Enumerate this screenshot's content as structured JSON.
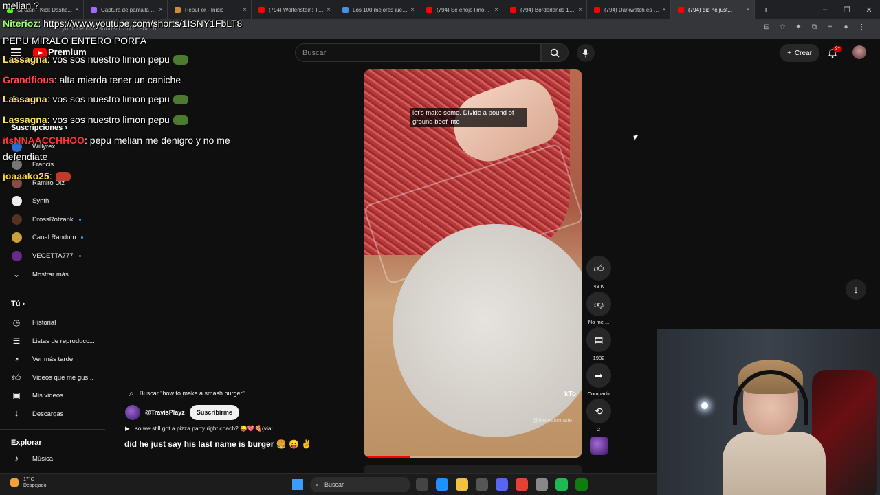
{
  "browser": {
    "tabs": [
      {
        "title": "Stream - Kick Dashb...",
        "color": "#53fc18"
      },
      {
        "title": "Captura de pantalla p...",
        "color": "#a06cff"
      },
      {
        "title": "PepuFor - Inicio",
        "color": "#d08a3a"
      },
      {
        "title": "(794) Wolfenstein: Th...",
        "color": "#ff0000"
      },
      {
        "title": "Los 100 mejores jueg...",
        "color": "#4a90e2"
      },
      {
        "title": "(794) Se enojo limón...",
        "color": "#ff0000"
      },
      {
        "title": "(794) Borderlands 1 f...",
        "color": "#ff0000"
      },
      {
        "title": "(794) Darkwatch es u...",
        "color": "#ff0000"
      },
      {
        "title": "(794) did he just...",
        "color": "#ff0000",
        "active": true
      }
    ],
    "url": "youtube.com/shorts/1ISNY1FbLT8"
  },
  "youtube": {
    "premium_label": "Premium",
    "search_placeholder": "Buscar",
    "create_label": "Crear",
    "notif_badge": "9+"
  },
  "sidebar": {
    "subscriptions_heading": "Suscripciones",
    "channels": [
      {
        "name": "Willyrex",
        "color": "#2a6fd6"
      },
      {
        "name": "Francis",
        "color": "#777777"
      },
      {
        "name": "Ramiro Diz",
        "color": "#8a4a4a"
      },
      {
        "name": "Synth",
        "color": "#eeeeee"
      },
      {
        "name": "DrossRotzank",
        "color": "#553322",
        "dot": true
      },
      {
        "name": "Canal Random",
        "color": "#c9a23a",
        "dot": true
      },
      {
        "name": "VEGETTA777",
        "color": "#6b2a8a",
        "dot": true
      }
    ],
    "show_more": "Mostrar más",
    "you_heading": "Tú",
    "you_items": [
      "Historial",
      "Listas de reproducc...",
      "Ver más tarde",
      "Videos que me gus...",
      "Mis videos",
      "Descargas"
    ],
    "explore_heading": "Explorar",
    "explore_items": [
      "Música"
    ]
  },
  "chat": [
    {
      "user": "",
      "text": "melian ?",
      "user_color": "#ffffff"
    },
    {
      "user": "Niterioz",
      "text": ": https://www.youtube.com/shorts/1ISNY1FbLT8",
      "user_color": "#9dff6a"
    },
    {
      "user": "",
      "text": "PEPU MIRALO ENTERO PORFA",
      "user_color": "#ffffff"
    },
    {
      "user": "Lassagna",
      "text": ": vos sos nuestro limon pepu",
      "user_color": "#ffe066"
    },
    {
      "user": "Grandfious",
      "text": ": alta mierda tener un caniche",
      "user_color": "#ff4d4d"
    },
    {
      "user": "Lassagna",
      "text": ": vos sos nuestro limon pepu",
      "user_color": "#ffe066"
    },
    {
      "user": "Lassagna",
      "text": ": vos sos nuestro limon pepu",
      "user_color": "#ffe066"
    },
    {
      "user": "itsNNAACCHHOO",
      "text": ": pepu melian me denigro y no me",
      "user_color": "#ff3333"
    },
    {
      "user": "",
      "text": "defendiate",
      "user_color": "#ffffff"
    },
    {
      "user": "joaaako25",
      "text": ":",
      "user_color": "#ffd84a"
    }
  ],
  "video": {
    "caption": "let's make some. Divide a pound of ground beef into",
    "watermark": "kTo",
    "watermark_sub": "@thementmatte",
    "progress": 0.21
  },
  "actions": {
    "like_count": "49 K",
    "dislike_label": "No me ...",
    "comments_count": "1932",
    "share_label": "Compartir",
    "remix_count": "2"
  },
  "info": {
    "search_suggestion": "Buscar \"how to make a smash burger\"",
    "channel": "@TravisPlayz",
    "subscribe": "Suscribirme",
    "description": "so we still got a pizza party right coach? 😜💖🍕(via:",
    "title": "did he just say his last name is burger 🍔 😛 ✌️"
  },
  "taskbar": {
    "temp": "17°C",
    "weather": "Despejado",
    "search": "Buscar",
    "apps": [
      "#444444",
      "#1e90ff",
      "#f0c040",
      "#555555",
      "#5865f2",
      "#e34133",
      "#888888",
      "#1db954",
      "#107c10"
    ]
  }
}
